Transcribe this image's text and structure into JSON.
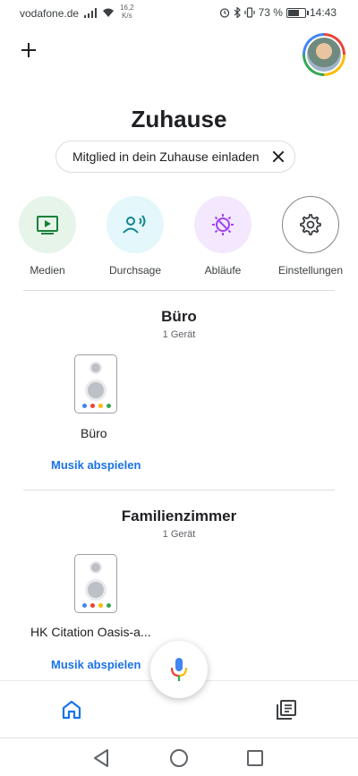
{
  "status_bar": {
    "carrier": "vodafone.de",
    "speed_value": "16,2",
    "speed_unit": "K/s",
    "battery": "73 %",
    "battery_level": 0.73,
    "time": "14:43"
  },
  "header": {
    "title": "Zuhause",
    "invite_chip_label": "Mitglied in dein Zuhause einladen"
  },
  "quick_actions": [
    {
      "label": "Medien",
      "icon": "media-play-icon",
      "bg": "#e6f4ea",
      "color": "#188038"
    },
    {
      "label": "Durchsage",
      "icon": "broadcast-person-icon",
      "bg": "#e4f7fb",
      "color": "#12858f"
    },
    {
      "label": "Abläufe",
      "icon": "routines-sun-icon",
      "bg": "#f3e8fd",
      "color": "#a142f4"
    },
    {
      "label": "Einstellungen",
      "icon": "gear-icon",
      "bg": "#ffffff",
      "color": "#3c4043"
    }
  ],
  "rooms": [
    {
      "name": "Büro",
      "count": "1 Gerät",
      "device_name": "Büro",
      "action": "Musik abspielen"
    },
    {
      "name": "Familienzimmer",
      "count": "1 Gerät",
      "device_name": "HK Citation Oasis-a...",
      "action": "Musik abspielen"
    }
  ],
  "colors": {
    "accent_blue": "#1a73e8",
    "google_blue": "#4285f4",
    "google_red": "#ea4335",
    "google_yellow": "#fbbc04",
    "google_green": "#34a853"
  }
}
